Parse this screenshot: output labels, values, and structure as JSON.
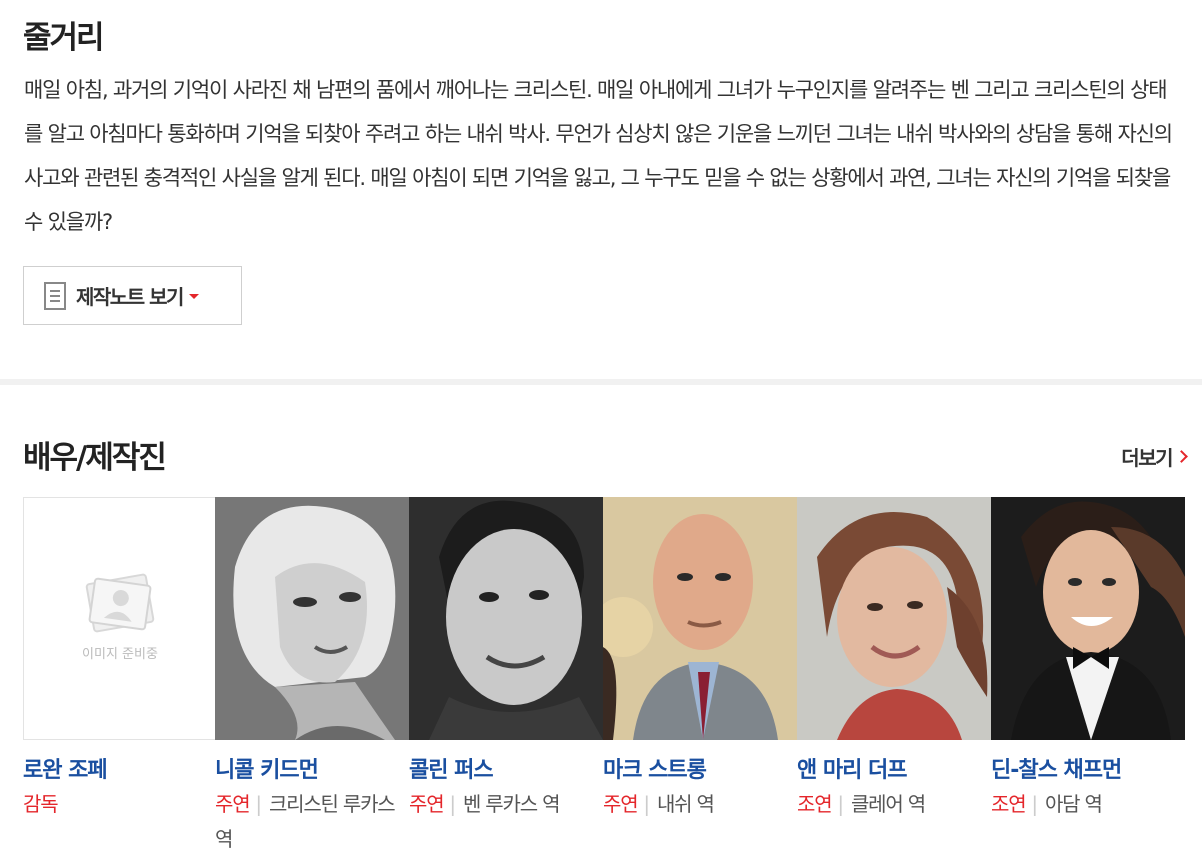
{
  "synopsis": {
    "title": "줄거리",
    "text": "매일 아침, 과거의 기억이 사라진 채 남편의 품에서 깨어나는 크리스틴. 매일 아내에게 그녀가 누구인지를 알려주는 벤 그리고 크리스틴의 상태를 알고 아침마다 통화하며 기억을 되찾아 주려고 하는 내쉬 박사. 무언가 심상치 않은 기운을 느끼던 그녀는 내쉬 박사와의 상담을 통해 자신의 사고와 관련된 충격적인 사실을 알게 된다. 매일 아침이 되면 기억을 잃고, 그 누구도 믿을 수 없는 상황에서 과연, 그녀는 자신의 기억을 되찾을 수 있을까?",
    "note_button_label": "제작노트 보기"
  },
  "cast": {
    "title": "배우/제작진",
    "more_label": "더보기",
    "members": [
      {
        "name": "로완 조페",
        "role_type": "감독",
        "role_desc": "",
        "photo": "placeholder",
        "placeholder_text": "이미지 준비중"
      },
      {
        "name": "니콜 키드먼",
        "role_type": "주연",
        "role_desc": "크리스틴 루카스 역",
        "photo": "portrait-bw-woman"
      },
      {
        "name": "콜린 퍼스",
        "role_type": "주연",
        "role_desc": "벤 루카스 역",
        "photo": "portrait-bw-man"
      },
      {
        "name": "마크 스트롱",
        "role_type": "주연",
        "role_desc": "내쉬 역",
        "photo": "portrait-bald-man"
      },
      {
        "name": "앤 마리 더프",
        "role_type": "조연",
        "role_desc": "클레어 역",
        "photo": "portrait-woman"
      },
      {
        "name": "딘-찰스 채프먼",
        "role_type": "조연",
        "role_desc": "아담 역",
        "photo": "portrait-young-man"
      }
    ]
  },
  "colors": {
    "accent_red": "#e4262b",
    "name_blue": "#1a4fa0",
    "divider": "#f1f1f1"
  }
}
